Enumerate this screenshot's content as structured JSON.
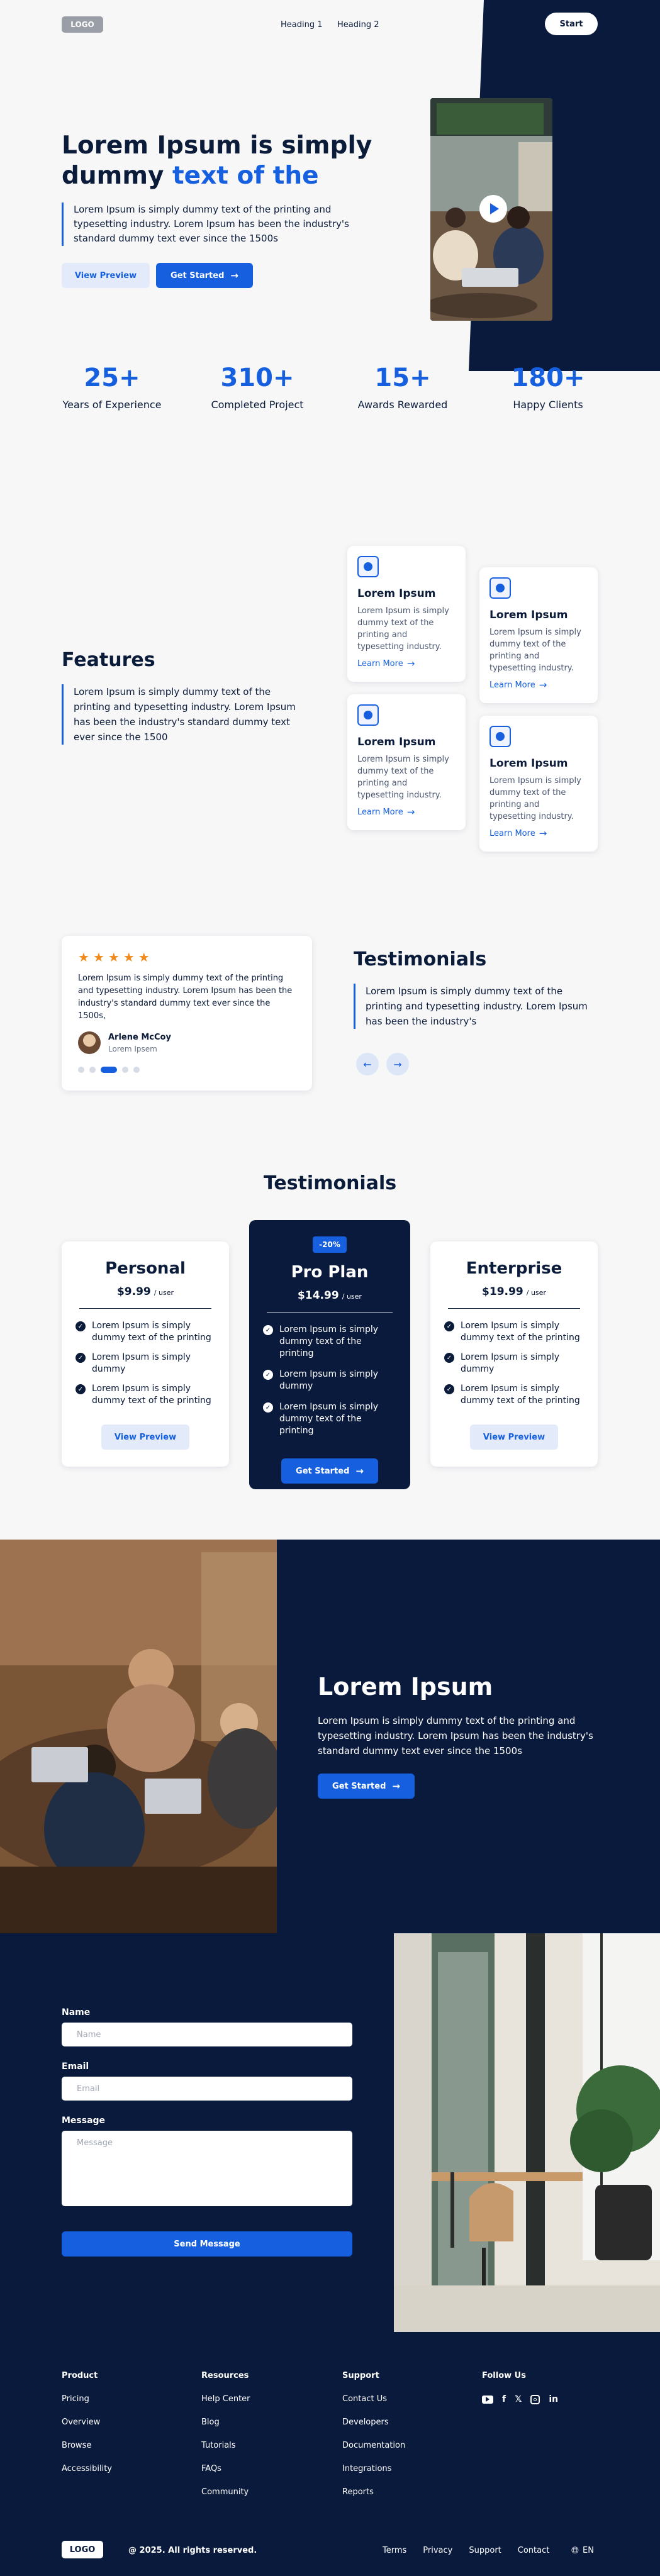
{
  "nav": {
    "logo": "LOGO",
    "links": [
      "Heading 1",
      "Heading 2"
    ],
    "start": "Start"
  },
  "hero": {
    "title_part1": "Lorem Ipsum is simply dummy ",
    "title_highlight": "text of the",
    "description": "Lorem Ipsum is simply dummy text of the printing and typesetting industry. Lorem Ipsum has been the industry's standard dummy text ever since the 1500s",
    "btn_preview": "View Preview",
    "btn_start": "Get Started"
  },
  "stats": [
    {
      "value": "25+",
      "label": "Years of Experience"
    },
    {
      "value": "310+",
      "label": "Completed Project"
    },
    {
      "value": "15+",
      "label": "Awards Rewarded"
    },
    {
      "value": "180+",
      "label": "Happy Clients"
    }
  ],
  "features": {
    "title": "Features",
    "description": "Lorem Ipsum is simply dummy text of the printing and typesetting industry. Lorem Ipsum has been the industry's standard dummy text ever since the 1500",
    "cards": [
      {
        "title": "Lorem Ipsum",
        "text": "Lorem Ipsum is simply dummy text of the printing and typesetting industry.",
        "link": "Learn More"
      },
      {
        "title": "Lorem Ipsum",
        "text": "Lorem Ipsum is simply dummy text of the printing and typesetting industry.",
        "link": "Learn More"
      },
      {
        "title": "Lorem Ipsum",
        "text": "Lorem Ipsum is simply dummy text of the printing and typesetting industry.",
        "link": "Learn More"
      },
      {
        "title": "Lorem Ipsum",
        "text": "Lorem Ipsum is simply dummy text of the printing and typesetting industry.",
        "link": "Learn More"
      }
    ]
  },
  "testimonials": {
    "title": "Testimonials",
    "description": "Lorem Ipsum is simply dummy text of the printing and typesetting industry. Lorem Ipsum has been the industry's",
    "rating": 5,
    "quote": "Lorem Ipsum is simply dummy text of the printing and typesetting industry. Lorem Ipsum has been the industry's standard dummy text ever since the 1500s,",
    "author": "Arlene McCoy",
    "role": "Lorem Ipsem",
    "active_slide": 3,
    "slides": 5
  },
  "pricing": {
    "title": "Testimonials",
    "plans": [
      {
        "name": "Personal",
        "price": "$9.99",
        "unit": "/ user",
        "features": [
          "Lorem Ipsum is simply dummy text of the printing",
          "Lorem Ipsum is simply dummy",
          "Lorem Ipsum is simply dummy text of the printing"
        ],
        "button": "View Preview"
      },
      {
        "name": "Pro Plan",
        "badge": "-20%",
        "price": "$14.99",
        "unit": "/ user",
        "features": [
          "Lorem Ipsum is simply dummy text of the printing",
          "Lorem Ipsum is simply dummy",
          "Lorem Ipsum is simply dummy text of the printing"
        ],
        "button": "Get Started"
      },
      {
        "name": "Enterprise",
        "price": "$19.99",
        "unit": "/ user",
        "features": [
          "Lorem Ipsum is simply dummy text of the printing",
          "Lorem Ipsum is simply dummy",
          "Lorem Ipsum is simply dummy text of the printing"
        ],
        "button": "View Preview"
      }
    ]
  },
  "cta": {
    "title": "Lorem Ipsum",
    "description": "Lorem Ipsum is simply dummy text of the printing and typesetting industry. Lorem Ipsum has been the industry's standard dummy text ever since the 1500s",
    "button": "Get Started"
  },
  "contact": {
    "name_label": "Name",
    "name_placeholder": "Name",
    "email_label": "Email",
    "email_placeholder": "Email",
    "message_label": "Message",
    "message_placeholder": "Message",
    "button": "Send Message"
  },
  "footer": {
    "columns": [
      {
        "title": "Product",
        "links": [
          "Pricing",
          "Overview",
          "Browse",
          "Accessibility"
        ]
      },
      {
        "title": "Resources",
        "links": [
          "Help Center",
          "Blog",
          "Tutorials",
          "FAQs",
          "Community"
        ]
      },
      {
        "title": "Support",
        "links": [
          "Contact Us",
          "Developers",
          "Documentation",
          "Integrations",
          "Reports"
        ]
      }
    ],
    "follow_title": "Follow Us",
    "social_icons": [
      "youtube-icon",
      "facebook-icon",
      "twitter-icon",
      "instagram-icon",
      "linkedin-icon"
    ],
    "logo": "LOGO",
    "copyright": "@ 2025. All rights reserved.",
    "bottom_links": [
      "Terms",
      "Privacy",
      "Support",
      "Contact"
    ],
    "language": "EN"
  },
  "colors": {
    "navy": "#0a1a3c",
    "accent": "#1660e0",
    "star": "#f08a1c"
  }
}
